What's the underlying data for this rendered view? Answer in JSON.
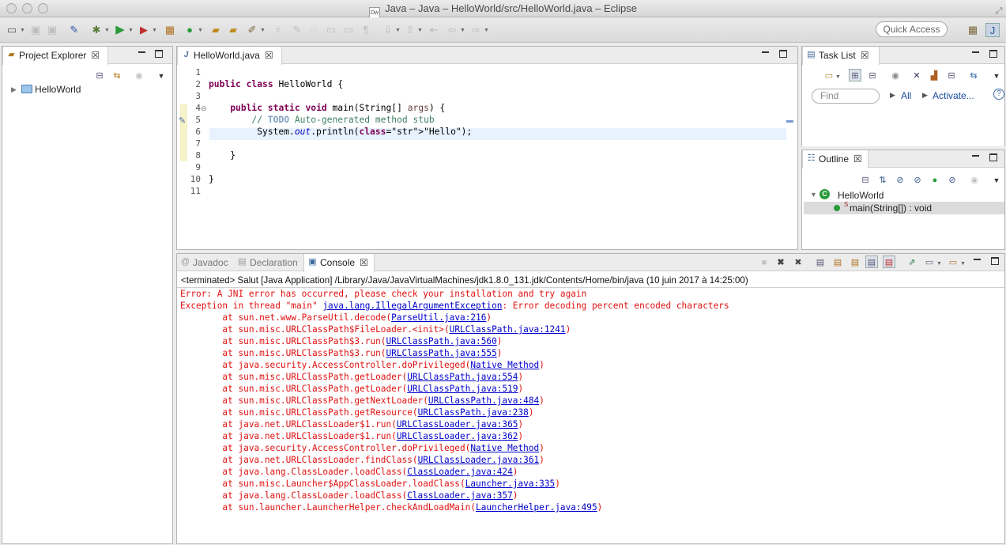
{
  "window": {
    "title": "Java – Java – HelloWorld/src/HelloWorld.java – Eclipse",
    "doc_icon_text": "Dw"
  },
  "toolbar": {
    "quick_access_label": "Quick Access",
    "icons": [
      "new-icon",
      "save-icon",
      "save-all-icon",
      "toggle-breakpoint-icon",
      "debug-icon",
      "run-icon",
      "external-tools-icon",
      "new-java-project-icon",
      "new-class-icon",
      "open-type-icon",
      "open-task-icon",
      "search-icon",
      "annotation-icon",
      "highlight-icon",
      "toggle-mark-icon",
      "next-annotation-icon",
      "previous-annotation-icon",
      "back-icon",
      "forward-icon"
    ]
  },
  "project_explorer": {
    "tab_label": "Project Explorer",
    "tree": [
      {
        "label": "HelloWorld",
        "expanded": false
      }
    ]
  },
  "editor": {
    "tab_label": "HelloWorld.java",
    "lines": [
      {
        "n": "1",
        "text": ""
      },
      {
        "n": "2",
        "text": "public class HelloWorld {"
      },
      {
        "n": "3",
        "text": ""
      },
      {
        "n": "4",
        "text": "    public static void main(String[] args) {"
      },
      {
        "n": "5",
        "text": "        // TODO Auto-generated method stub"
      },
      {
        "n": "6",
        "text": "         System.out.println(\"Hello\");"
      },
      {
        "n": "7",
        "text": ""
      },
      {
        "n": "8",
        "text": "    }"
      },
      {
        "n": "9",
        "text": ""
      },
      {
        "n": "10",
        "text": "}"
      },
      {
        "n": "11",
        "text": ""
      }
    ],
    "current_line": 6
  },
  "task_list": {
    "tab_label": "Task List",
    "find_placeholder": "Find",
    "all_label": "All",
    "activate_label": "Activate..."
  },
  "outline": {
    "tab_label": "Outline",
    "class_name": "HelloWorld",
    "method": "main(String[]) : void",
    "method_modifier": "S"
  },
  "bottom_panel": {
    "tabs": [
      "Javadoc",
      "Declaration",
      "Console"
    ],
    "active_tab": "Console",
    "terminated_line": "<terminated> Salut [Java Application] /Library/Java/JavaVirtualMachines/jdk1.8.0_131.jdk/Contents/Home/bin/java (10 juin 2017 à 14:25:00)"
  },
  "console": {
    "error_line": "Error: A JNI error has occurred, please check your installation and try again",
    "exception": {
      "prefix": "Exception in thread \"main\" ",
      "link": "java.lang.IllegalArgumentException",
      "suffix": ": Error decoding percent encoded characters"
    },
    "stack": [
      {
        "method": "sun.net.www.ParseUtil.decode",
        "location": "ParseUtil.java:216"
      },
      {
        "method": "sun.misc.URLClassPath$FileLoader.<init>",
        "location": "URLClassPath.java:1241"
      },
      {
        "method": "sun.misc.URLClassPath$3.run",
        "location": "URLClassPath.java:560"
      },
      {
        "method": "sun.misc.URLClassPath$3.run",
        "location": "URLClassPath.java:555"
      },
      {
        "method": "java.security.AccessController.doPrivileged",
        "location": "Native Method"
      },
      {
        "method": "sun.misc.URLClassPath.getLoader",
        "location": "URLClassPath.java:554"
      },
      {
        "method": "sun.misc.URLClassPath.getLoader",
        "location": "URLClassPath.java:519"
      },
      {
        "method": "sun.misc.URLClassPath.getNextLoader",
        "location": "URLClassPath.java:484"
      },
      {
        "method": "sun.misc.URLClassPath.getResource",
        "location": "URLClassPath.java:238"
      },
      {
        "method": "java.net.URLClassLoader$1.run",
        "location": "URLClassLoader.java:365"
      },
      {
        "method": "java.net.URLClassLoader$1.run",
        "location": "URLClassLoader.java:362"
      },
      {
        "method": "java.security.AccessController.doPrivileged",
        "location": "Native Method"
      },
      {
        "method": "java.net.URLClassLoader.findClass",
        "location": "URLClassLoader.java:361"
      },
      {
        "method": "java.lang.ClassLoader.loadClass",
        "location": "ClassLoader.java:424"
      },
      {
        "method": "sun.misc.Launcher$AppClassLoader.loadClass",
        "location": "Launcher.java:335"
      },
      {
        "method": "java.lang.ClassLoader.loadClass",
        "location": "ClassLoader.java:357"
      },
      {
        "method": "sun.launcher.LauncherHelper.checkAndLoadMain",
        "location": "LauncherHelper.java:495"
      }
    ]
  },
  "colors": {
    "error_text": "#e01010",
    "link": "#0000cc",
    "keyword": "#7f0055",
    "comment": "#3f7f5f",
    "string": "#2a00ff",
    "current_line_bg": "#e8f2fe"
  }
}
